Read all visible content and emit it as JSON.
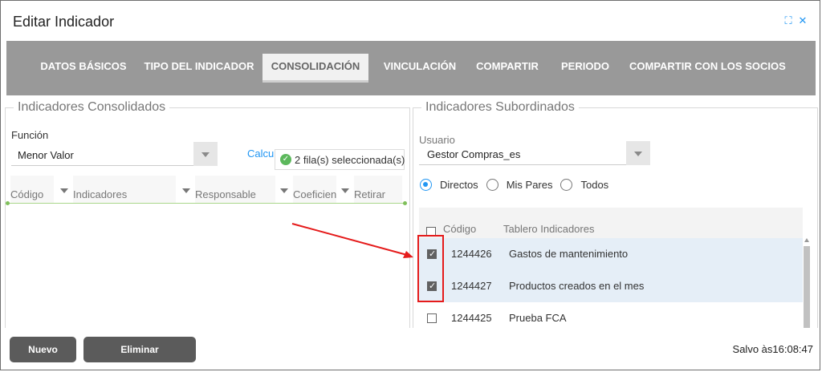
{
  "dialog": {
    "title": "Editar Indicador",
    "icons": [
      "expand-icon",
      "close-icon"
    ]
  },
  "tabs": [
    {
      "label": "DATOS BÁSICOS"
    },
    {
      "label": "TIPO DEL INDICADOR"
    },
    {
      "label": "CONSOLIDACIÓN",
      "active": true
    },
    {
      "label": "VINCULACIÓN"
    },
    {
      "label": "COMPARTIR"
    },
    {
      "label": "PERIODO"
    },
    {
      "label": "COMPARTIR CON LOS SOCIOS"
    }
  ],
  "left_panel": {
    "legend": "Indicadores Consolidados",
    "function_label": "Función",
    "function_value": "Menor Valor",
    "calculate_link": "Calcular",
    "columns": [
      "Código",
      "Indicadores",
      "Responsable",
      "Coeficien",
      "Retirar"
    ],
    "toast": "2 fila(s) seleccionada(s)"
  },
  "right_panel": {
    "legend": "Indicadores Subordinados",
    "user_label": "Usuario",
    "user_value": "Gestor Compras_es",
    "radios": [
      {
        "label": "Directos",
        "checked": true
      },
      {
        "label": "Mis Pares",
        "checked": false
      },
      {
        "label": "Todos",
        "checked": false
      }
    ],
    "grid_columns": [
      "Código",
      "Tablero Indicadores"
    ],
    "rows": [
      {
        "code": "1244426",
        "name": "Gastos de mantenimiento",
        "checked": true
      },
      {
        "code": "1244427",
        "name": "Productos creados en el mes",
        "checked": true
      },
      {
        "code": "1244425",
        "name": "Prueba FCA",
        "checked": false
      }
    ]
  },
  "footer": {
    "new_button": "Nuevo",
    "delete_button": "Eliminar",
    "saved_text": "Salvo às16:08:47"
  },
  "colors": {
    "accent": "#2196f3",
    "tab_bar": "#999999",
    "button": "#5b5b5b",
    "highlight": "#e51b1b",
    "selected_row": "#e5eef7"
  }
}
